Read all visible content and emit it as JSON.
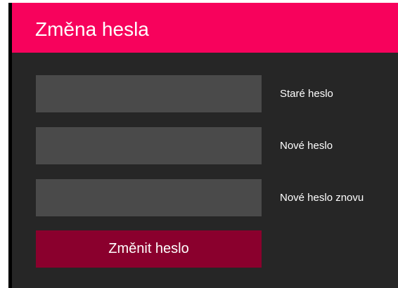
{
  "header": {
    "title": "Změna hesla"
  },
  "form": {
    "old_password_label": "Staré heslo",
    "new_password_label": "Nové heslo",
    "new_password_again_label": "Nové heslo znovu",
    "submit_label": "Změnit heslo"
  },
  "colors": {
    "accent": "#f7025c",
    "button": "#8a002d",
    "panel_bg": "#262626",
    "input_bg": "#4a4a4a"
  }
}
